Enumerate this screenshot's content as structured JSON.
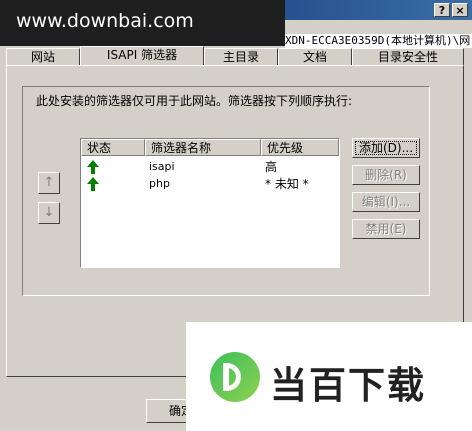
{
  "window": {
    "help_button": "?",
    "close_button": "×",
    "path_text": "XDN-ECCA3E0359D(本地计算机)\\网"
  },
  "watermark": {
    "text": "www.downbai.com"
  },
  "tabs": [
    "网站",
    "ISAPI 筛选器",
    "主目录",
    "文档",
    "目录安全性"
  ],
  "description": "此处安装的筛选器仅可用于此网站。筛选器按下列顺序执行:",
  "list": {
    "columns": [
      "状态",
      "筛选器名称",
      "优先级"
    ],
    "rows": [
      {
        "status_icon": "green-up-arrow-icon",
        "name": "isapi",
        "priority": "高"
      },
      {
        "status_icon": "green-up-arrow-icon",
        "name": "php",
        "priority": "* 未知 *"
      }
    ]
  },
  "buttons": {
    "add": "添加(D)...",
    "remove": "删除(R)",
    "edit": "编辑(I)...",
    "disable": "禁用(E)"
  },
  "movers": {
    "up": "↑",
    "down": "↓"
  },
  "bottom": {
    "ok": "确定"
  },
  "logo": {
    "text": "当百下载"
  }
}
